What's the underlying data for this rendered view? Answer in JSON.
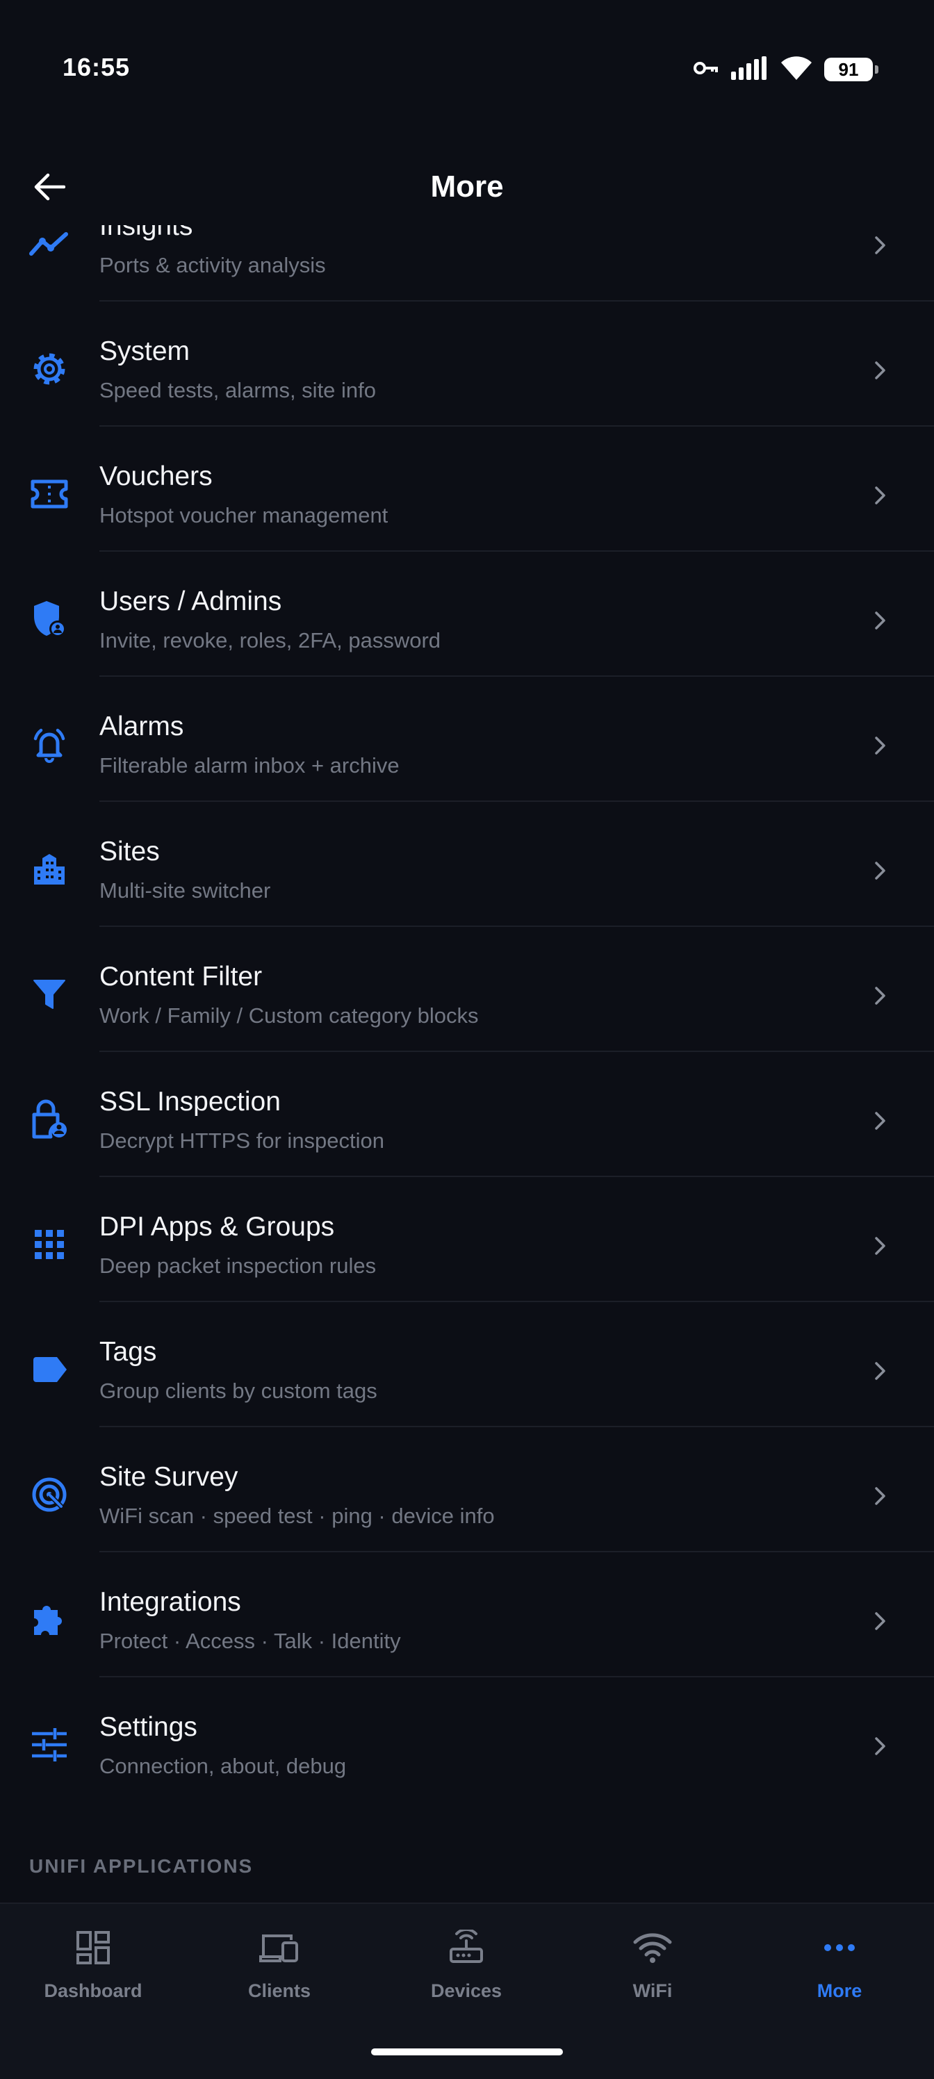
{
  "status_bar": {
    "time": "16:55",
    "battery": "91",
    "icons": [
      "vpn-key-icon",
      "signal-icon",
      "wifi-icon",
      "battery-icon"
    ]
  },
  "header": {
    "title": "More",
    "back_icon": "arrow-left-icon"
  },
  "colors": {
    "background": "#0c0e15",
    "accent": "#2f7bf5",
    "title_text": "#f3f4f7",
    "subtitle_text": "#737884",
    "divider": "#1c1f28"
  },
  "menu_items": [
    {
      "title": "Insights",
      "subtitle": "Ports & activity analysis",
      "icon": "insights-icon"
    },
    {
      "title": "System",
      "subtitle": "Speed tests, alarms, site info",
      "icon": "gear-icon"
    },
    {
      "title": "Vouchers",
      "subtitle": "Hotspot voucher management",
      "icon": "ticket-icon"
    },
    {
      "title": "Users / Admins",
      "subtitle": "Invite, revoke, roles, 2FA, password",
      "icon": "admin-shield-icon"
    },
    {
      "title": "Alarms",
      "subtitle": "Filterable alarm inbox + archive",
      "icon": "alarm-bell-icon"
    },
    {
      "title": "Sites",
      "subtitle": "Multi-site switcher",
      "icon": "buildings-icon"
    },
    {
      "title": "Content Filter",
      "subtitle": "Work / Family / Custom category blocks",
      "icon": "filter-icon"
    },
    {
      "title": "SSL Inspection",
      "subtitle": "Decrypt HTTPS for inspection",
      "icon": "lock-person-icon"
    },
    {
      "title": "DPI Apps & Groups",
      "subtitle": "Deep packet inspection rules",
      "icon": "apps-grid-icon"
    },
    {
      "title": "Tags",
      "subtitle": "Group clients by custom tags",
      "icon": "tag-icon"
    },
    {
      "title": "Site Survey",
      "subtitle": "WiFi scan · speed test · ping · device info",
      "icon": "radar-icon"
    },
    {
      "title": "Integrations",
      "subtitle": "Protect · Access · Talk · Identity",
      "icon": "puzzle-icon"
    },
    {
      "title": "Settings",
      "subtitle": "Connection, about, debug",
      "icon": "tune-icon"
    }
  ],
  "section_label": "UNIFI APPLICATIONS",
  "bottom_nav": [
    {
      "label": "Dashboard",
      "icon": "dashboard-icon",
      "active": false
    },
    {
      "label": "Clients",
      "icon": "devices-icon",
      "active": false
    },
    {
      "label": "Devices",
      "icon": "router-icon",
      "active": false
    },
    {
      "label": "WiFi",
      "icon": "wifi-icon",
      "active": false
    },
    {
      "label": "More",
      "icon": "more-dots-icon",
      "active": true
    }
  ]
}
